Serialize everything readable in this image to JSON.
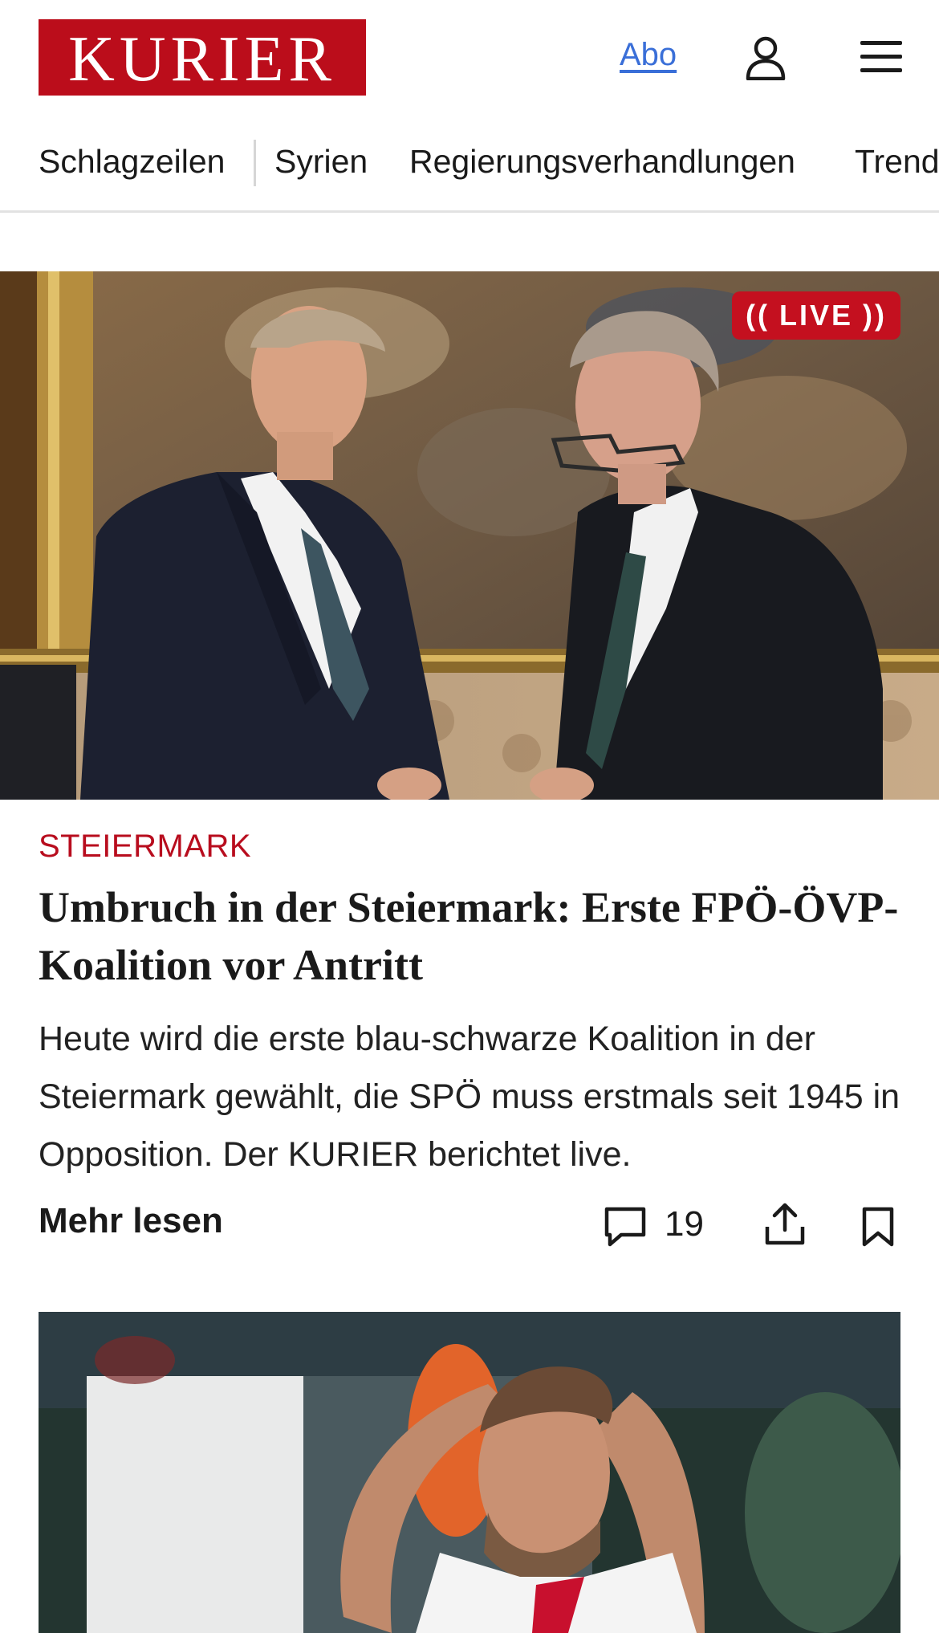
{
  "header": {
    "logo_text": "KURIER",
    "abo_label": "Abo",
    "brand_color": "#bb0d1b"
  },
  "icons": {
    "user": "user-icon",
    "menu": "hamburger-menu-icon",
    "comment": "comment-icon",
    "share": "share-icon",
    "bookmark": "bookmark-icon"
  },
  "nav": {
    "items": [
      {
        "label": "Schlagzeilen"
      },
      {
        "label": "Syrien"
      },
      {
        "label": "Regierungsverhandlungen"
      },
      {
        "label": "Trend"
      }
    ]
  },
  "hero": {
    "badge": "LIVE"
  },
  "article": {
    "kicker": "STEIERMARK",
    "headline": "Umbruch in der Steiermark: Erste FPÖ-ÖVP-Koalition vor Antritt",
    "teaser": "Heute wird die erste blau-schwarze Koalition in der Steiermark gewählt, die SPÖ muss erstmals seit 1945 in Opposition. Der KURIER berichtet live.",
    "more_label": "Mehr lesen",
    "comment_count": "19"
  }
}
